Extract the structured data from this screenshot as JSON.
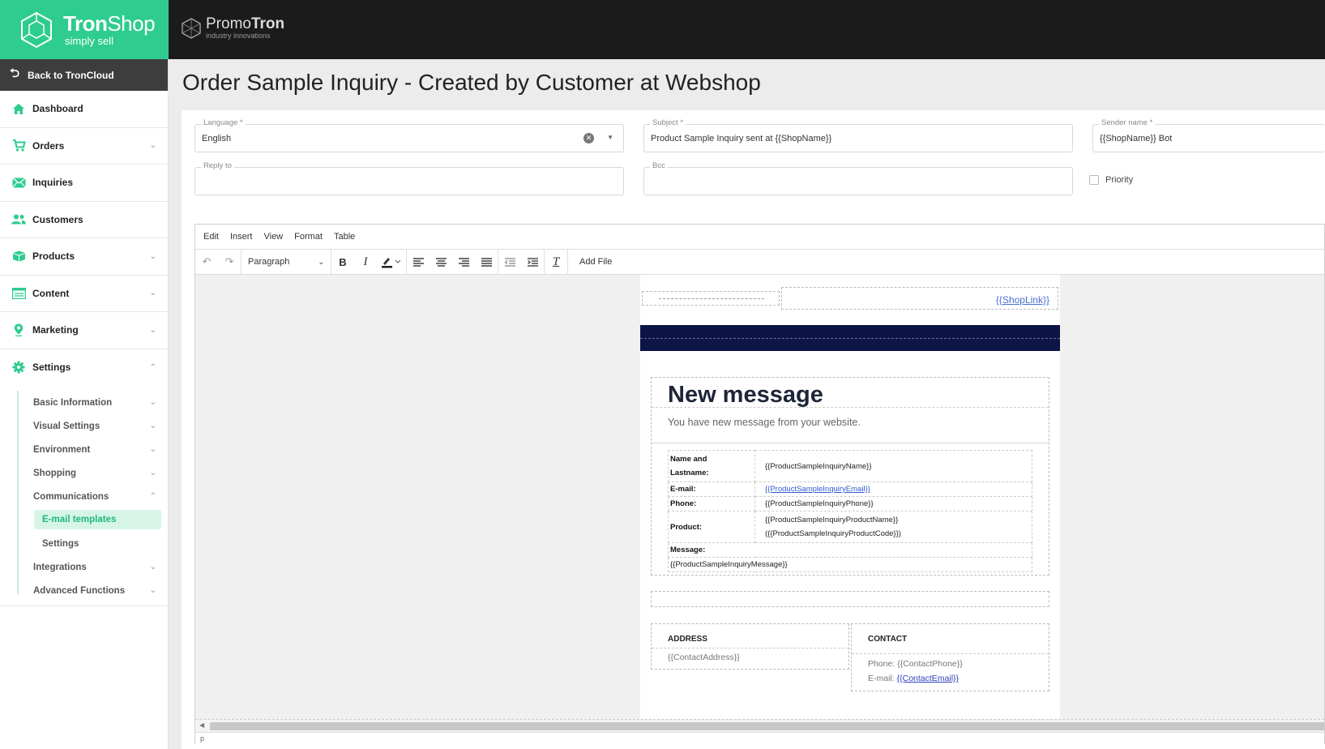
{
  "brand": {
    "name_bold": "Tron",
    "name_light": "Shop",
    "tagline": "simply sell"
  },
  "partner": {
    "name_light": "Promo",
    "name_bold": "Tron",
    "tagline": "industry innovations"
  },
  "sidebar": {
    "back_label": "Back to TronCloud",
    "items": [
      {
        "label": "Dashboard",
        "icon": "home-icon",
        "chevron": false
      },
      {
        "label": "Orders",
        "icon": "cart-icon",
        "chevron": true
      },
      {
        "label": "Inquiries",
        "icon": "envelope-icon",
        "chevron": false
      },
      {
        "label": "Customers",
        "icon": "users-icon",
        "chevron": false
      },
      {
        "label": "Products",
        "icon": "box-icon",
        "chevron": true
      },
      {
        "label": "Content",
        "icon": "content-icon",
        "chevron": true
      },
      {
        "label": "Marketing",
        "icon": "pin-icon",
        "chevron": true
      },
      {
        "label": "Settings",
        "icon": "gear-icon",
        "chevron": true
      }
    ],
    "settings_sub": [
      {
        "label": "Basic Information"
      },
      {
        "label": "Visual Settings"
      },
      {
        "label": "Environment"
      },
      {
        "label": "Shopping"
      },
      {
        "label": "Communications"
      },
      {
        "label": "Integrations"
      },
      {
        "label": "Advanced Functions"
      }
    ],
    "communications_sub": [
      {
        "label": "E-mail templates",
        "active": true
      },
      {
        "label": "Settings",
        "active": false
      }
    ]
  },
  "page": {
    "title": "Order Sample Inquiry - Created by Customer at Webshop"
  },
  "form": {
    "language": {
      "label": "Language *",
      "value": "English"
    },
    "subject": {
      "label": "Subject *",
      "value": "Product Sample Inquiry sent at {{ShopName}}"
    },
    "sender_name": {
      "label": "Sender name *",
      "value": "{{ShopName}} Bot"
    },
    "reply_to": {
      "label": "Reply to",
      "value": ""
    },
    "bcc": {
      "label": "Bcc",
      "value": ""
    },
    "priority": {
      "label": "Priority",
      "checked": false
    }
  },
  "editor": {
    "menu": [
      "Edit",
      "Insert",
      "View",
      "Format",
      "Table"
    ],
    "block_format": "Paragraph",
    "add_file": "Add File",
    "status": "p"
  },
  "email": {
    "shop_link": "{{ShopLink}}",
    "heading": "New message",
    "subheading": "You have new message from your website.",
    "rows": {
      "name_key_1": "Name and",
      "name_key_2": "Lastname:",
      "name_val": "{{ProductSampleInquiryName}}",
      "email_key": "E-mail:",
      "email_val": "{{ProductSampleInquiryEmail}}",
      "phone_key": "Phone:",
      "phone_val": "{{ProductSampleInquiryPhone}}",
      "product_key": "Product:",
      "product_val_1": "{{ProductSampleInquiryProductName}}",
      "product_val_2": "({{ProductSampleInquiryProductCode}})",
      "message_key": "Message:",
      "message_val": "{{ProductSampleInquiryMessage}}"
    },
    "address_heading": "ADDRESS",
    "address_val": "{{ContactAddress}}",
    "contact_heading": "CONTACT",
    "phone_prefix": "Phone: ",
    "phone_val": "{{ContactPhone}}",
    "email_prefix": "E-mail: ",
    "email_val": "{{ContactEmail}}"
  },
  "colors": {
    "accent": "#2ecc8f",
    "topbar": "#1b1b1b",
    "email_band": "#0d1446"
  }
}
